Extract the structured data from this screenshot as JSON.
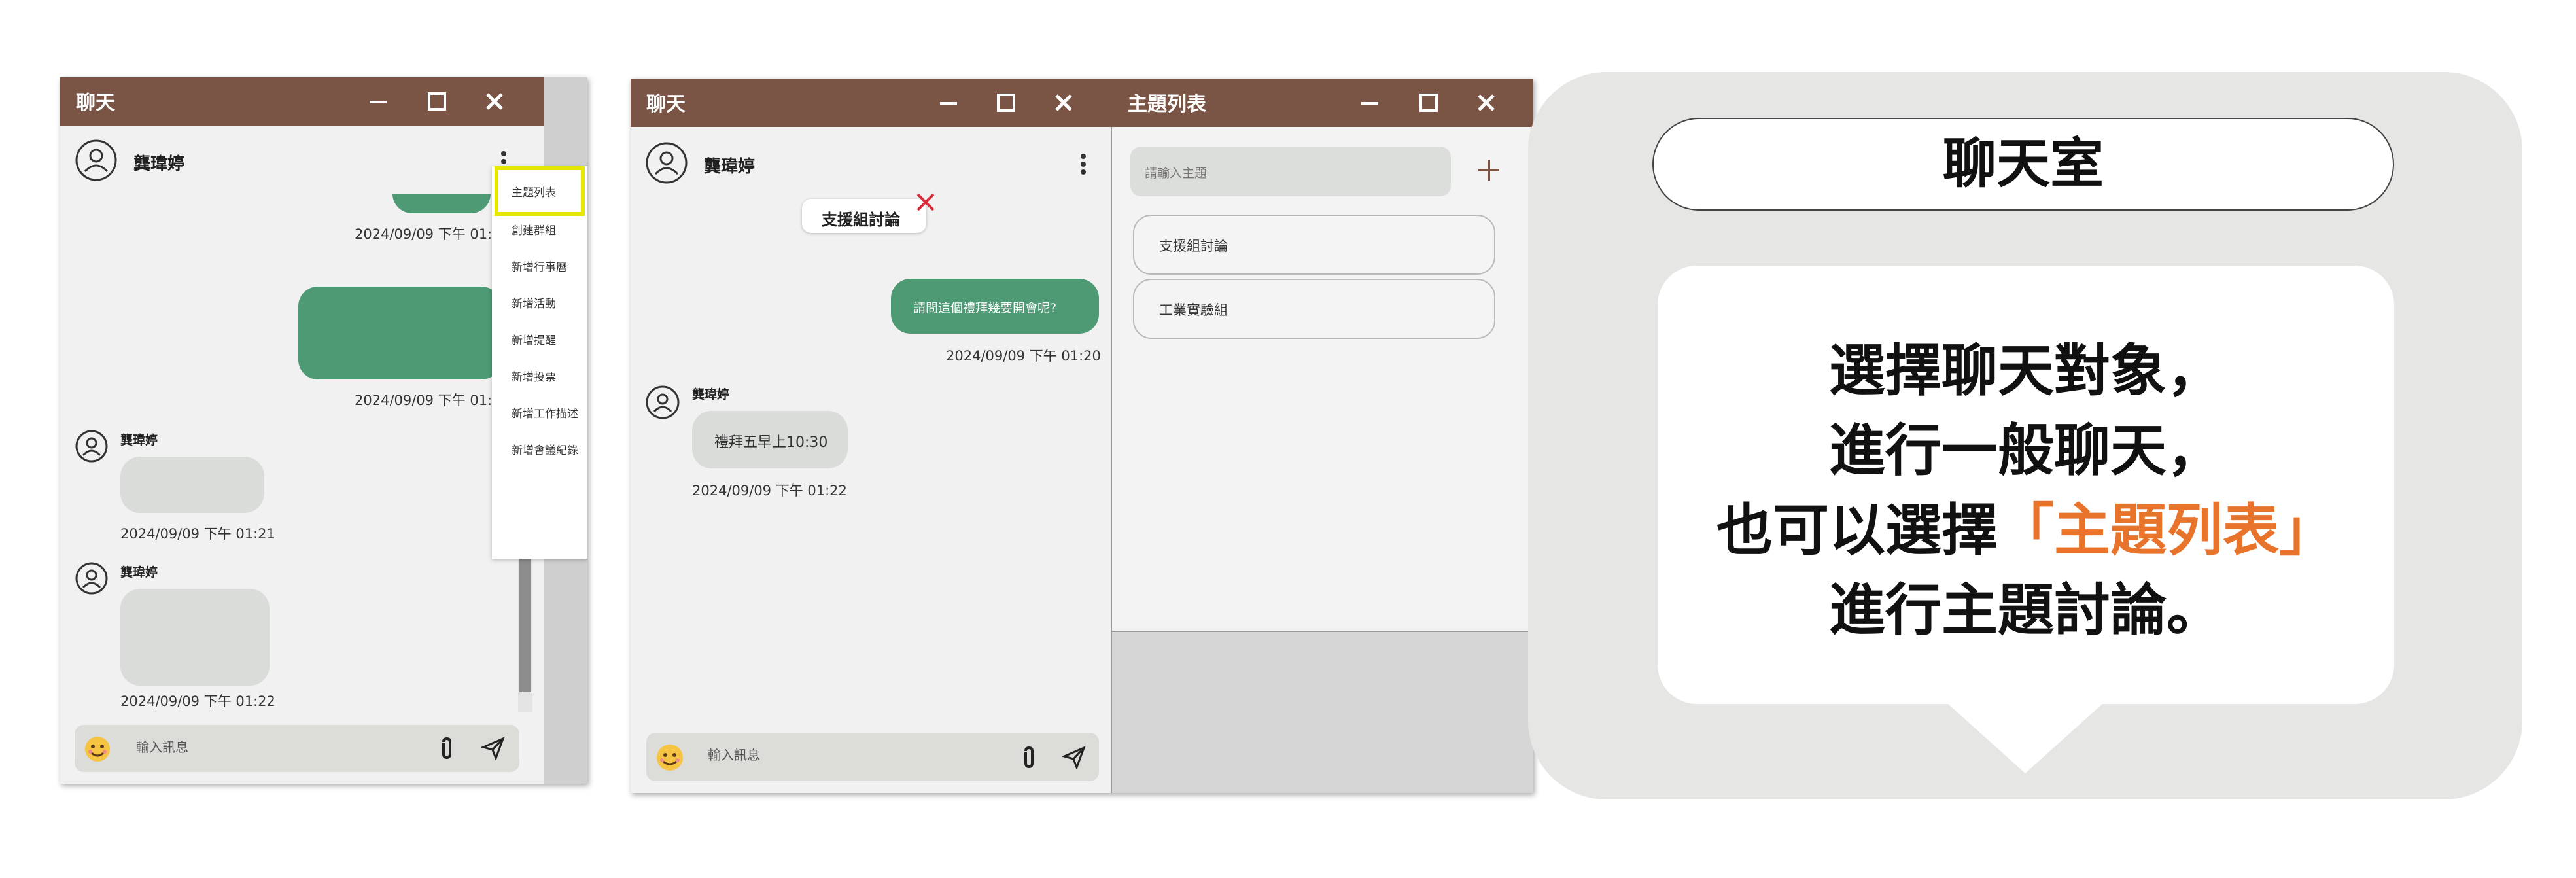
{
  "left_window": {
    "title": "聊天",
    "contact_name": "龔瑋婷",
    "timestamps": [
      "2024/09/09 下午 01:2",
      "2024/09/09 下午 01:2",
      "2024/09/09 下午 01:21",
      "2024/09/09 下午 01:22"
    ],
    "sender_names": [
      "龔瑋婷",
      "龔瑋婷"
    ],
    "menu_items": [
      "主題列表",
      "創建群組",
      "新增行事曆",
      "新增活動",
      "新增提醒",
      "新增投票",
      "新增工作描述",
      "新增會議紀錄"
    ],
    "input_placeholder": "輸入訊息"
  },
  "middle_window": {
    "title": "聊天",
    "contact_name": "龔瑋婷",
    "topic_chip": "支援組討論",
    "my_message": "請問這個禮拜幾要開會呢?",
    "my_timestamp": "2024/09/09 下午 01:20",
    "sender_name": "龔瑋婷",
    "other_message": "禮拜五早上10:30",
    "other_timestamp": "2024/09/09 下午 01:22",
    "input_placeholder": "輸入訊息"
  },
  "topic_window": {
    "title": "主題列表",
    "search_placeholder": "請輸入主題",
    "topics": [
      "支援組討論",
      "工業實驗組"
    ]
  },
  "callout": {
    "heading": "聊天室",
    "line1": "選擇聊天對象，",
    "line2": "進行一般聊天，",
    "line3_pre": "也可以選擇",
    "line3_highlight": "「主題列表」",
    "line4": "進行主題討論。",
    "highlight_color": "#e8732a"
  },
  "colors": {
    "titlebar": "#7a5546",
    "my_bubble": "#4d9a75",
    "other_bubble": "#d9dcd9",
    "menu_highlight": "#e6e600"
  },
  "icons": {
    "minimize": "minimize-icon",
    "maximize": "maximize-icon",
    "close": "close-icon",
    "avatar": "user-avatar-icon",
    "more": "more-vertical-icon",
    "emoji": "emoji-icon",
    "attach": "paperclip-icon",
    "send": "send-icon",
    "add": "plus-icon"
  }
}
